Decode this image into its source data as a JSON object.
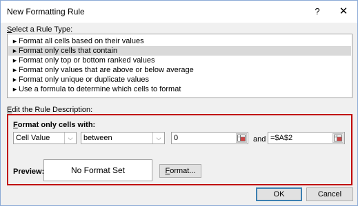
{
  "window": {
    "title": "New Formatting Rule",
    "help_glyph": "?",
    "close_glyph": "✕"
  },
  "rule_type": {
    "label_prefix": "S",
    "label_rest": "elect a Rule Type:",
    "items": [
      {
        "label": "Format all cells based on their values",
        "selected": false
      },
      {
        "label": "Format only cells that contain",
        "selected": true
      },
      {
        "label": "Format only top or bottom ranked values",
        "selected": false
      },
      {
        "label": "Format only values that are above or below average",
        "selected": false
      },
      {
        "label": "Format only unique or duplicate values",
        "selected": false
      },
      {
        "label": "Use a formula to determine which cells to format",
        "selected": false
      }
    ],
    "bullet": "►"
  },
  "description": {
    "label_prefix": "E",
    "label_rest": "dit the Rule Description:",
    "format_label_prefix": "F",
    "format_label_rest": "ormat only cells with:",
    "condition_combo": "Cell Value",
    "operator_combo": "between",
    "value1": "0",
    "and_text": "and",
    "value2": "=$A$2",
    "preview_label": "Preview:",
    "preview_text": "No Format Set",
    "format_button_prefix": "F",
    "format_button_rest": "ormat..."
  },
  "buttons": {
    "ok": "OK",
    "cancel": "Cancel"
  },
  "colors": {
    "highlight_border": "#c00000",
    "selection": "#d9d9d9",
    "accent": "#3c7fb1"
  }
}
